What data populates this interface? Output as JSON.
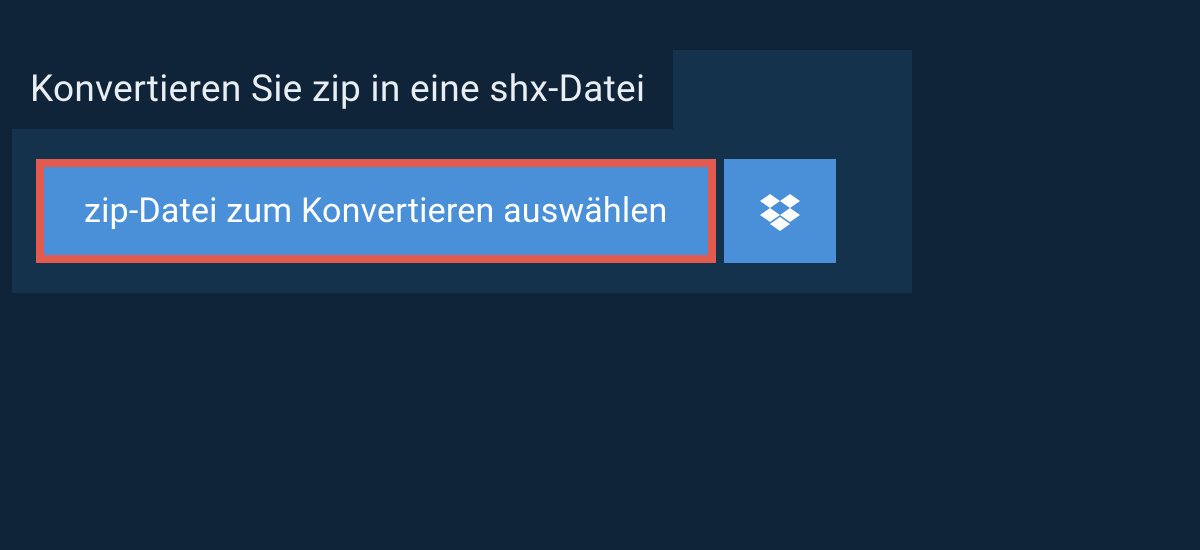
{
  "header": {
    "title": "Konvertieren Sie zip in eine shx-Datei"
  },
  "actions": {
    "select_file_label": "zip-Datei zum Konvertieren auswählen"
  },
  "colors": {
    "page_bg": "#0f2438",
    "panel_bg": "#15324d",
    "button_bg": "#4a90d9",
    "button_border": "#e35a4f",
    "text_light": "#ffffff",
    "title_text": "#e8eef3"
  }
}
